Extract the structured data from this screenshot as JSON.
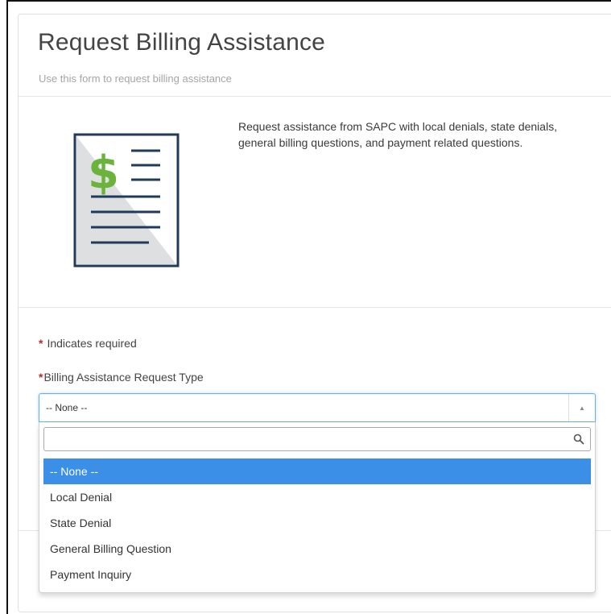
{
  "form": {
    "title": "Request Billing Assistance",
    "subtitle": "Use this form to request billing assistance",
    "description": "Request assistance from SAPC with local denials, state denials, general billing questions, and payment related questions.",
    "illustration_icon": "billing-document-icon",
    "required_marker": "*",
    "required_note": "Indicates required"
  },
  "field": {
    "label": "Billing Assistance Request Type",
    "selected_value": "-- None --",
    "search_placeholder": "",
    "search_icon": "search-icon",
    "arrow_glyph": "▲",
    "options": [
      {
        "label": "-- None --",
        "selected": true
      },
      {
        "label": "Local Denial",
        "selected": false
      },
      {
        "label": "State Denial",
        "selected": false
      },
      {
        "label": "General Billing Question",
        "selected": false
      },
      {
        "label": "Payment Inquiry",
        "selected": false
      }
    ]
  },
  "colors": {
    "accent": "#3b8fe6",
    "focus_border": "#66afe9",
    "required": "#c0262d",
    "dollar_green": "#6bb33d",
    "icon_navy": "#1f3b5c"
  }
}
